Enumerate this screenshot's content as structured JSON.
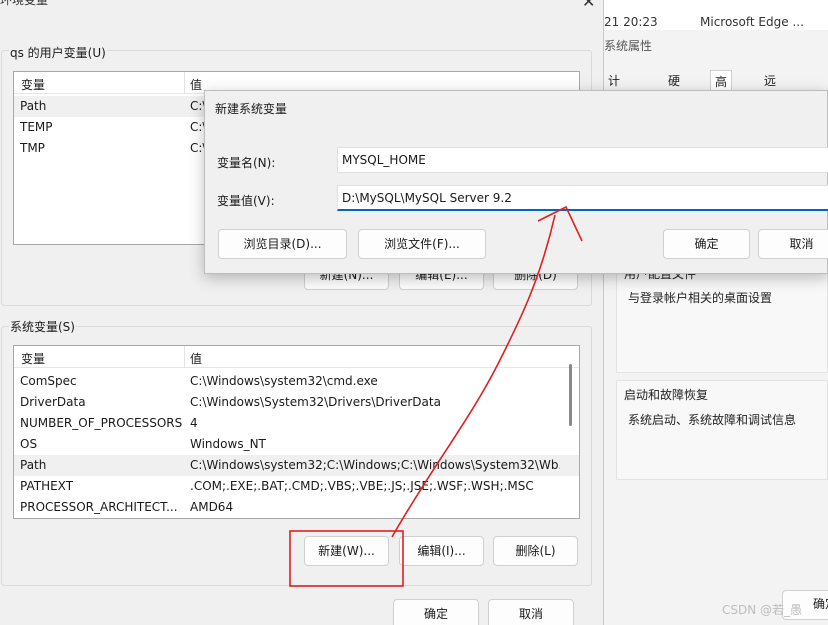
{
  "background_window": {
    "timestamp": "21 20:23",
    "browser": "Microsoft Edge ...",
    "title": "系统属性",
    "tabs": [
      {
        "label": "计算机名",
        "active": false
      },
      {
        "label": "硬件",
        "active": false
      },
      {
        "label": "高级",
        "active": true
      },
      {
        "label": "远程",
        "active": false
      }
    ],
    "profile_heading": "用户配置文件",
    "profile_desc": "与登录帐户相关的桌面设置",
    "startup_heading": "启动和故障恢复",
    "startup_desc": "系统启动、系统故障和调试信息",
    "partial_button": "确定"
  },
  "env_window": {
    "title": "环境变量",
    "user_group_label": "qs 的用户变量(U)",
    "user_vars": {
      "headers": [
        "变量",
        "值"
      ],
      "rows": [
        {
          "name": "Path",
          "value": "C:\\"
        },
        {
          "name": "TEMP",
          "value": "C:\\"
        },
        {
          "name": "TMP",
          "value": "C:\\"
        }
      ],
      "buttons": [
        "新建(N)...",
        "编辑(E)...",
        "删除(D)"
      ]
    },
    "system_group_label": "系统变量(S)",
    "system_vars": {
      "headers": [
        "变量",
        "值"
      ],
      "rows": [
        {
          "name": "ComSpec",
          "value": "C:\\Windows\\system32\\cmd.exe"
        },
        {
          "name": "DriverData",
          "value": "C:\\Windows\\System32\\Drivers\\DriverData"
        },
        {
          "name": "NUMBER_OF_PROCESSORS",
          "value": "4"
        },
        {
          "name": "OS",
          "value": "Windows_NT"
        },
        {
          "name": "Path",
          "value": "C:\\Windows\\system32;C:\\Windows;C:\\Windows\\System32\\Wb..."
        },
        {
          "name": "PATHEXT",
          "value": ".COM;.EXE;.BAT;.CMD;.VBS;.VBE;.JS;.JSE;.WSF;.WSH;.MSC"
        },
        {
          "name": "PROCESSOR_ARCHITECT...",
          "value": "AMD64"
        }
      ],
      "buttons": [
        "新建(W)...",
        "编辑(I)...",
        "删除(L)"
      ]
    },
    "ok": "确定",
    "cancel": "取消"
  },
  "dialog": {
    "title": "新建系统变量",
    "name_label": "变量名(N):",
    "name_value": "MYSQL_HOME",
    "value_label": "变量值(V):",
    "value_value": "D:\\MySQL\\MySQL Server 9.2",
    "browse_dir": "浏览目录(D)...",
    "browse_file": "浏览文件(F)...",
    "ok": "确定",
    "cancel": "取消"
  },
  "watermark": "CSDN @若_愚",
  "colors": {
    "annotation_red": "#e02020",
    "focus_blue": "#0067c0"
  }
}
